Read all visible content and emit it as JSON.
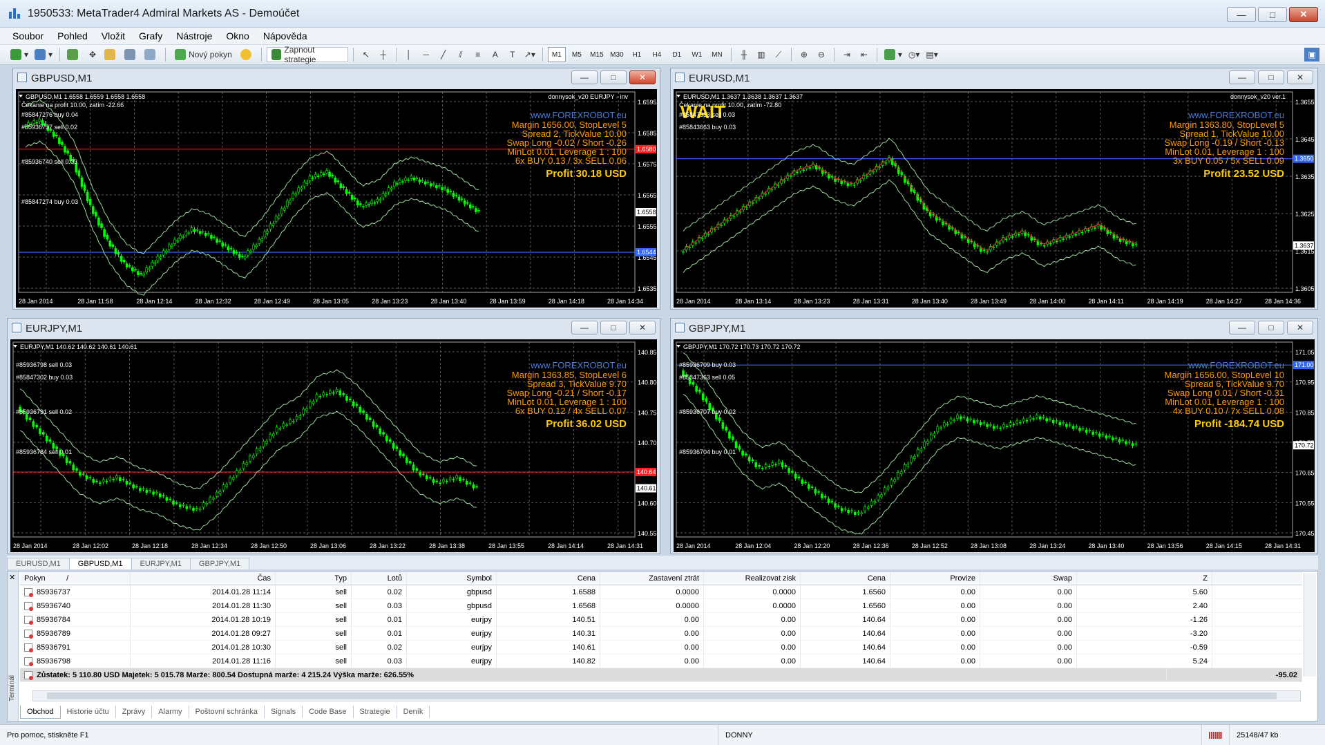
{
  "window": {
    "title": "1950533: MetaTrader4 Admiral Markets AS - Demoúčet",
    "buttons": [
      "—",
      "□",
      "✕"
    ]
  },
  "menu": [
    "Soubor",
    "Pohled",
    "Vložit",
    "Grafy",
    "Nástroje",
    "Okno",
    "Nápověda"
  ],
  "toolbar": {
    "new_order": "Nový pokyn",
    "enable_strategies": "Zapnout strategie",
    "timeframes": [
      "M1",
      "M5",
      "M15",
      "M30",
      "H1",
      "H4",
      "D1",
      "W1",
      "MN"
    ],
    "text_tool": "A"
  },
  "charts": [
    {
      "title": "GBPUSD,M1",
      "header": "GBPUSD,M1 1.6558 1.6559 1.6558 1.6558",
      "subheader": "Čekanie na profit 10.00, zatím -22.66",
      "ea": "donnysok_v20 EURJPY - inv",
      "wait": "",
      "info_site": "www.FOREXROBOT.eu",
      "info_lines": [
        "Margin 1656.00, StopLevel 5",
        "Spread 2, TickValue 10.00",
        "Swap Long -0.02 / Short -0.26",
        "MinLot 0.01, Leverage 1 : 100",
        "6x BUY 0.13 / 3x SELL 0.06"
      ],
      "profit": "Profit 30.18 USD",
      "price_labels": [
        "1.6595",
        "1.6585",
        "1.6575",
        "1.6565",
        "1.6555",
        "1.6545",
        "1.6535"
      ],
      "hl_red_label": "1.6580",
      "hl_blue_label": "1.6544",
      "current_label": "1.6558",
      "time_labels": [
        "28 Jan 2014",
        "28 Jan 11:58",
        "28 Jan 12:14",
        "28 Jan 12:32",
        "28 Jan 12:49",
        "28 Jan 13:05",
        "28 Jan 13:23",
        "28 Jan 13:40",
        "28 Jan 13:59",
        "28 Jan 14:18",
        "28 Jan 14:34"
      ],
      "orders": [
        "#85847276 buy 0.04",
        "#85936737 sell 0.02",
        "#85936740 sell 0.03",
        "#85847274 buy 0.03"
      ],
      "series": [
        1.6588,
        1.659,
        1.6584,
        1.6575,
        1.656,
        1.6548,
        1.654,
        1.6536,
        1.6542,
        1.6548,
        1.6552,
        1.655,
        1.6546,
        1.6542,
        1.6548,
        1.6556,
        1.6564,
        1.657,
        1.6572,
        1.6566,
        1.656,
        1.6562,
        1.6568,
        1.657,
        1.6568,
        1.6566,
        1.6562,
        1.6558
      ],
      "ymin": 1.653,
      "ymax": 1.66,
      "red": 1.658,
      "blue": 1.6544
    },
    {
      "title": "EURUSD,M1",
      "header": "EURUSD,M1 1.3637 1.3638 1.3637 1.3637",
      "subheader": "Čekanie na profit 10.00, zatím -72.80",
      "ea": "donnysok_v20 ver.1",
      "wait": "WAIT",
      "info_site": "www.FOREXROBOT.eu",
      "info_lines": [
        "Margin 1363.80, StopLevel 5",
        "Spread 1, TickValue 10.00",
        "Swap Long -0.19 / Short -0.13",
        "MinLot 0.01, Leverage 1 : 100",
        "3x BUY 0.05 / 5x SELL 0.09"
      ],
      "profit": "Profit 23.52 USD",
      "price_labels": [
        "1.3655",
        "1.3645",
        "1.3635",
        "1.3625",
        "1.3615",
        "1.3605"
      ],
      "hl_red_label": "",
      "hl_blue_label": "1.3650",
      "current_label": "1.3637",
      "time_labels": [
        "28 Jan 2014",
        "28 Jan 13:14",
        "28 Jan 13:23",
        "28 Jan 13:31",
        "28 Jan 13:40",
        "28 Jan 13:49",
        "28 Jan 14:00",
        "28 Jan 14:11",
        "28 Jan 14:19",
        "28 Jan 14:27",
        "28 Jan 14:36"
      ],
      "orders": [
        "#85847333 sell 0.03",
        "#85843663 buy 0.03"
      ],
      "series": [
        1.3636,
        1.3638,
        1.364,
        1.3642,
        1.3644,
        1.3646,
        1.3648,
        1.3649,
        1.3647,
        1.3646,
        1.3648,
        1.365,
        1.3646,
        1.3642,
        1.364,
        1.3638,
        1.3636,
        1.3638,
        1.3639,
        1.3637,
        1.3638,
        1.3639,
        1.364,
        1.3638,
        1.3637
      ],
      "ymin": 1.363,
      "ymax": 1.366,
      "red": null,
      "blue": 1.365
    },
    {
      "title": "EURJPY,M1",
      "header": "EURJPY,M1 140.62 140.62 140.61 140.61",
      "subheader": "",
      "ea": "",
      "wait": "",
      "info_site": "www.FOREXROBOT.eu",
      "info_lines": [
        "Margin 1363.85, StopLevel 6",
        "Spread 3, TickValue 9.70",
        "Swap Long -0.21 / Short -0.17",
        "MinLot 0.01, Leverage 1 : 100",
        "6x BUY 0.12 / 4x SELL 0.07"
      ],
      "profit": "Profit 36.02 USD",
      "price_labels": [
        "140.85",
        "140.80",
        "140.75",
        "140.70",
        "140.65",
        "140.60",
        "140.55"
      ],
      "hl_red_label": "140.64",
      "hl_blue_label": "",
      "current_label": "140.61",
      "time_labels": [
        "28 Jan 2014",
        "28 Jan 12:02",
        "28 Jan 12:18",
        "28 Jan 12:34",
        "28 Jan 12:50",
        "28 Jan 13:06",
        "28 Jan 13:22",
        "28 Jan 13:38",
        "28 Jan 13:55",
        "28 Jan 14:14",
        "28 Jan 14:31"
      ],
      "orders": [
        "#85936798 sell 0.03",
        "#85847302 buy 0.03",
        "#85936791 sell 0.02",
        "#85936784 sell 0.01"
      ],
      "series": [
        140.76,
        140.72,
        140.68,
        140.64,
        140.62,
        140.63,
        140.61,
        140.6,
        140.58,
        140.57,
        140.6,
        140.64,
        140.68,
        140.72,
        140.74,
        140.78,
        140.79,
        140.76,
        140.72,
        140.68,
        140.64,
        140.62,
        140.63,
        140.61
      ],
      "ymin": 140.52,
      "ymax": 140.88,
      "red": 140.64,
      "blue": null
    },
    {
      "title": "GBPJPY,M1",
      "header": "GBPJPY,M1 170.72 170.73 170.72 170.72",
      "subheader": "",
      "ea": "",
      "wait": "",
      "info_site": "www.FOREXROBOT.eu",
      "info_lines": [
        "Margin 1656.00, StopLevel 10",
        "Spread 6, TickValue 9.70",
        "Swap Long 0.01 / Short -0.31",
        "MinLot 0.01, Leverage 1 : 100",
        "4x BUY 0.10 / 7x SELL 0.08"
      ],
      "profit": "Profit -184.74 USD",
      "price_labels": [
        "171.05",
        "170.95",
        "170.85",
        "170.75",
        "170.65",
        "170.55",
        "170.45"
      ],
      "hl_red_label": "",
      "hl_blue_label": "171.00",
      "current_label": "170.72",
      "time_labels": [
        "28 Jan 2014",
        "28 Jan 12:04",
        "28 Jan 12:20",
        "28 Jan 12:36",
        "28 Jan 12:52",
        "28 Jan 13:08",
        "28 Jan 13:24",
        "28 Jan 13:40",
        "28 Jan 13:56",
        "28 Jan 14:15",
        "28 Jan 14:31"
      ],
      "orders": [
        "#85936709 buy 0.03",
        "#85847363 sell 0.05",
        "#85936707 buy 0.02",
        "#85936704 buy 0.01"
      ],
      "series": [
        170.98,
        170.9,
        170.8,
        170.7,
        170.64,
        170.66,
        170.6,
        170.55,
        170.5,
        170.48,
        170.54,
        170.62,
        170.7,
        170.78,
        170.82,
        170.8,
        170.78,
        170.8,
        170.82,
        170.8,
        170.78,
        170.76,
        170.74,
        170.72
      ],
      "ymin": 170.4,
      "ymax": 171.08,
      "red": null,
      "blue": 171.0
    }
  ],
  "chart_tabs": [
    "EURUSD,M1",
    "GBPUSD,M1",
    "EURJPY,M1",
    "GBPJPY,M1"
  ],
  "terminal": {
    "label": "Terminál",
    "columns": [
      "Pokyn",
      "Čas",
      "Typ",
      "Lotů",
      "Symbol",
      "Cena",
      "Zastavení ztrát",
      "Realizovat zisk",
      "Cena",
      "Provize",
      "Swap",
      "Z"
    ],
    "sort_marker": "/",
    "rows": [
      [
        "85936737",
        "2014.01.28 11:14",
        "sell",
        "0.02",
        "gbpusd",
        "1.6588",
        "0.0000",
        "0.0000",
        "1.6560",
        "0.00",
        "0.00",
        "5.60"
      ],
      [
        "85936740",
        "2014.01.28 11:30",
        "sell",
        "0.03",
        "gbpusd",
        "1.6568",
        "0.0000",
        "0.0000",
        "1.6560",
        "0.00",
        "0.00",
        "2.40"
      ],
      [
        "85936784",
        "2014.01.28 10:19",
        "sell",
        "0.01",
        "eurjpy",
        "140.51",
        "0.00",
        "0.00",
        "140.64",
        "0.00",
        "0.00",
        "-1.26"
      ],
      [
        "85936789",
        "2014.01.28 09:27",
        "sell",
        "0.01",
        "eurjpy",
        "140.31",
        "0.00",
        "0.00",
        "140.64",
        "0.00",
        "0.00",
        "-3.20"
      ],
      [
        "85936791",
        "2014.01.28 10:30",
        "sell",
        "0.02",
        "eurjpy",
        "140.61",
        "0.00",
        "0.00",
        "140.64",
        "0.00",
        "0.00",
        "-0.59"
      ],
      [
        "85936798",
        "2014.01.28 11:16",
        "sell",
        "0.03",
        "eurjpy",
        "140.82",
        "0.00",
        "0.00",
        "140.64",
        "0.00",
        "0.00",
        "5.24"
      ]
    ],
    "summary": "Zůstatek: 5 110.80 USD  Majetek: 5 015.78  Marže: 800.54  Dostupná marže: 4 215.24  Výška marže: 626.55%",
    "summary_total": "-95.02",
    "tabs": [
      "Obchod",
      "Historie účtu",
      "Zprávy",
      "Alarmy",
      "Poštovní schránka",
      "Signals",
      "Code Base",
      "Strategie",
      "Deník"
    ]
  },
  "status": {
    "help": "Pro pomoc, stiskněte F1",
    "profile": "DONNY",
    "traffic": "25148/47 kb"
  },
  "colors": {
    "bull": "#00ff00",
    "info": "#ff9900",
    "site": "#4a7bd9",
    "profit": "#ffcc00",
    "red_line": "#ff2020",
    "blue_line": "#3366ff"
  }
}
